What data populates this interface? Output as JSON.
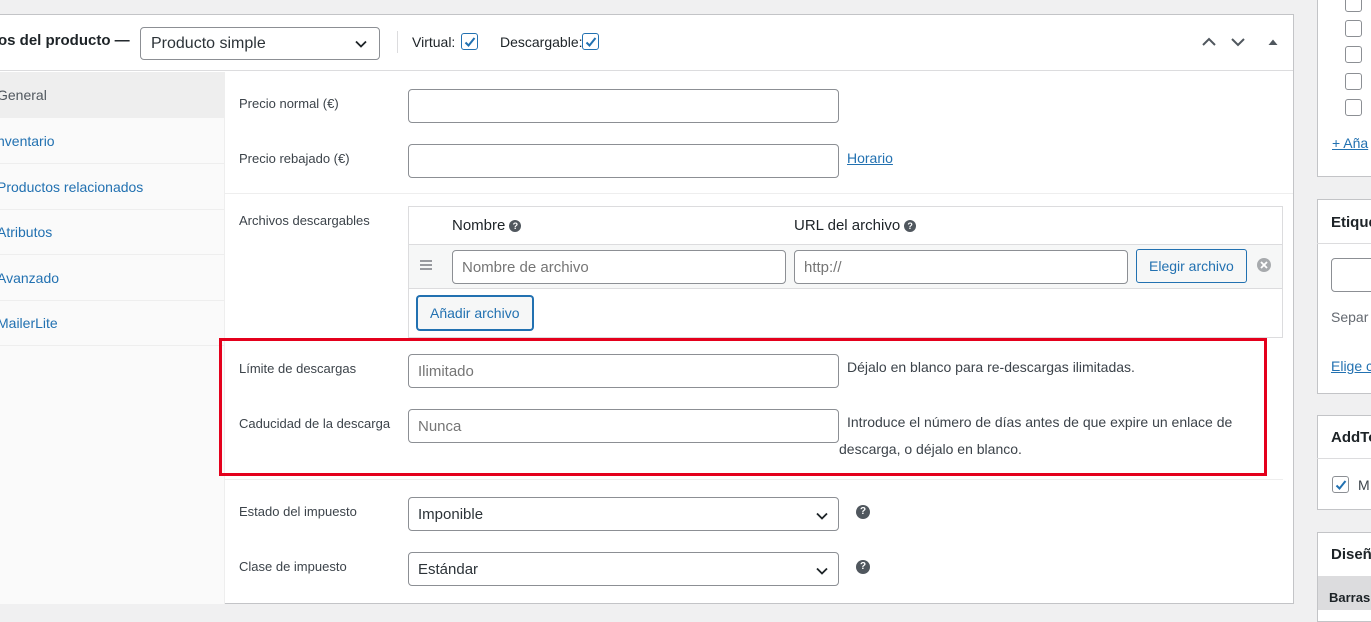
{
  "product_data": {
    "title": "os del producto —",
    "product_type": "Producto simple",
    "virtual_label": "Virtual:",
    "virtual_checked": true,
    "downloadable_label": "Descargable:",
    "downloadable_checked": true
  },
  "tabs": [
    {
      "label": "General",
      "active": true
    },
    {
      "label": "nventario",
      "active": false
    },
    {
      "label": "Productos relacionados",
      "active": false
    },
    {
      "label": "Atributos",
      "active": false
    },
    {
      "label": "Avanzado",
      "active": false
    },
    {
      "label": "MailerLite",
      "active": false
    }
  ],
  "pricing": {
    "regular_price_label": "Precio normal (€)",
    "regular_price_value": "",
    "sale_price_label": "Precio rebajado (€)",
    "sale_price_value": "",
    "schedule_link": "Horario"
  },
  "downloads": {
    "label": "Archivos descargables",
    "col_name": "Nombre",
    "col_url": "URL del archivo",
    "name_placeholder": "Nombre de archivo",
    "url_value": "http://",
    "choose_file_button": "Elegir archivo",
    "add_file_button": "Añadir archivo"
  },
  "download_limit": {
    "label": "Límite de descargas",
    "placeholder": "Ilimitado",
    "description": "Déjalo en blanco para re-descargas ilimitadas."
  },
  "download_expiry": {
    "label": "Caducidad de la descarga",
    "placeholder": "Nunca",
    "description_line1": "Introduce el número de días antes de que expire un enlace de",
    "description_line2": "descarga, o déjalo en blanco."
  },
  "tax": {
    "status_label": "Estado del impuesto",
    "status_value": "Imponible",
    "class_label": "Clase de impuesto",
    "class_value": "Estándar"
  },
  "sidebar": {
    "add_category_link": "+ Aña",
    "tags_title": "Etique",
    "tags_hint": "Separ",
    "tags_choose_link": "Elige c",
    "addto_title": "AddTo",
    "addto_option": "M",
    "design_title": "Diseñ",
    "bars_title": "Barras"
  },
  "colors": {
    "accent": "#2271b1",
    "highlight_border": "#e4001c"
  }
}
